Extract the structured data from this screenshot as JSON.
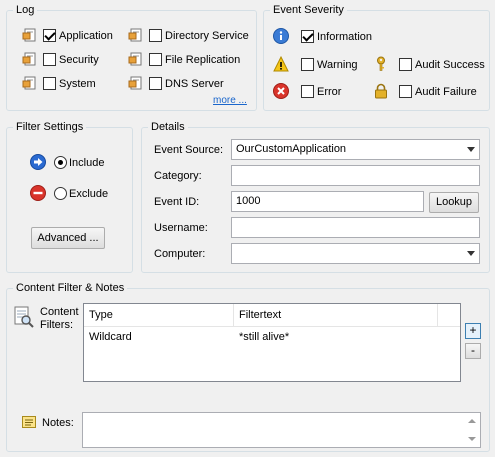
{
  "log": {
    "title": "Log",
    "items": [
      {
        "label": "Application",
        "checked": true,
        "icon": "log-icon"
      },
      {
        "label": "Security",
        "checked": false,
        "icon": "log-icon"
      },
      {
        "label": "System",
        "checked": false,
        "icon": "log-icon"
      },
      {
        "label": "Directory Service",
        "checked": false,
        "icon": "log-icon"
      },
      {
        "label": "File Replication",
        "checked": false,
        "icon": "log-icon"
      },
      {
        "label": "DNS Server",
        "checked": false,
        "icon": "log-icon"
      }
    ],
    "more_label": "more ..."
  },
  "severity": {
    "title": "Event Severity",
    "information": "Information",
    "warning": "Warning",
    "error": "Error",
    "audit_success": "Audit Success",
    "audit_failure": "Audit Failure",
    "information_checked": true,
    "warning_checked": false,
    "error_checked": false,
    "audit_success_checked": false,
    "audit_failure_checked": false
  },
  "filter_settings": {
    "title": "Filter Settings",
    "include_label": "Include",
    "exclude_label": "Exclude",
    "selected": "Include",
    "advanced_label": "Advanced ..."
  },
  "details": {
    "title": "Details",
    "event_source_label": "Event Source:",
    "event_source_value": "OurCustomApplication",
    "category_label": "Category:",
    "category_value": "",
    "event_id_label": "Event ID:",
    "event_id_value": "1000",
    "lookup_label": "Lookup",
    "username_label": "Username:",
    "username_value": "",
    "computer_label": "Computer:",
    "computer_value": ""
  },
  "content_filter": {
    "title": "Content Filter & Notes",
    "filters_label_line1": "Content",
    "filters_label_line2": "Filters:",
    "columns": [
      "Type",
      "Filtertext"
    ],
    "rows": [
      {
        "type": "Wildcard",
        "filtertext": "*still alive*"
      }
    ],
    "add_label": "+",
    "remove_label": "-",
    "notes_label": "Notes:",
    "notes_value": ""
  },
  "colors": {
    "info_blue": "#3a7bd5",
    "error_red": "#d9342b",
    "warning_yellow": "#f5c518",
    "include_blue": "#2a6ad1",
    "exclude_red": "#d9342b",
    "link_blue": "#1a66cc"
  }
}
